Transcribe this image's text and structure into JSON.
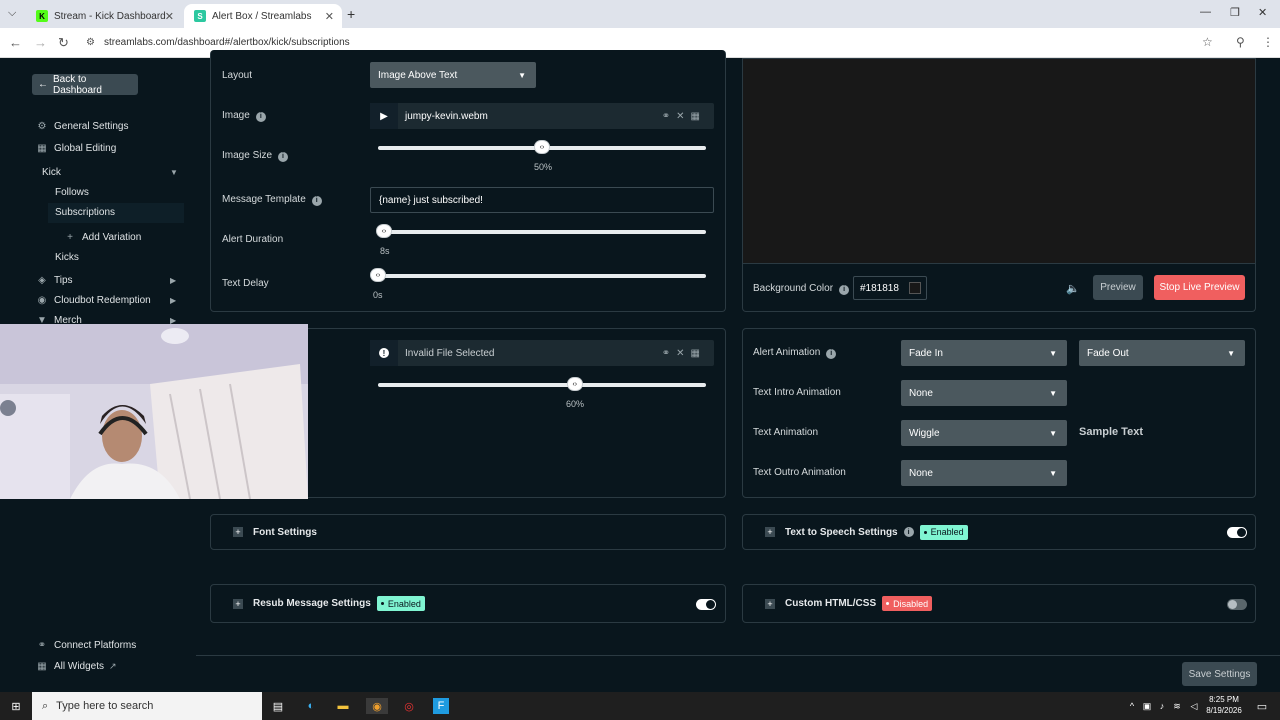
{
  "browser": {
    "tabs": [
      {
        "title": "Stream - Kick Dashboard",
        "fav": "K",
        "fav_color": "#53fc18"
      },
      {
        "title": "Alert Box / Streamlabs",
        "fav": "S",
        "fav_color": "#2cc8a0"
      }
    ],
    "url": "streamlabs.com/dashboard#/alertbox/kick/subscriptions"
  },
  "sidebar": {
    "back_label": "Back to Dashboard",
    "items": [
      {
        "label": "General Settings",
        "icon": "gear-icon"
      },
      {
        "label": "Global Editing",
        "icon": "grid-icon"
      },
      {
        "label": "Kick"
      },
      {
        "label": "Follows"
      },
      {
        "label": "Subscriptions"
      },
      {
        "label": "Add Variation"
      },
      {
        "label": "Kicks"
      },
      {
        "label": "Tips",
        "icon": "tag-icon"
      },
      {
        "label": "Cloudbot Redemption",
        "icon": "bot-icon"
      },
      {
        "label": "Merch",
        "icon": "shirt-icon"
      }
    ],
    "connect": "Connect Platforms",
    "widgets": "All Widgets"
  },
  "settings": {
    "layout_label": "Layout",
    "layout_value": "Image Above Text",
    "image_label": "Image",
    "image_file": "jumpy-kevin.webm",
    "image_size_label": "Image Size",
    "image_size_value": "50%",
    "image_size_fraction": 0.5,
    "message_template_label": "Message Template",
    "message_template_value": "{name} just subscribed!",
    "alert_duration_label": "Alert Duration",
    "alert_duration_value": "8s",
    "text_delay_label": "Text Delay",
    "text_delay_value": "0s",
    "sound_file": "Invalid File Selected",
    "sound_volume_value": "60%",
    "sound_volume_fraction": 0.6
  },
  "preview": {
    "bg_color_label": "Background Color",
    "bg_color_value": "#181818",
    "preview_btn": "Preview",
    "stop_btn": "Stop Live Preview"
  },
  "animation": {
    "alert_label": "Alert Animation",
    "alert_in": "Fade In",
    "alert_out": "Fade Out",
    "intro_label": "Text Intro Animation",
    "intro_value": "None",
    "text_label": "Text Animation",
    "text_value": "Wiggle",
    "sample": "Sample Text",
    "outro_label": "Text Outro Animation",
    "outro_value": "None"
  },
  "sections": {
    "font": "Font Settings",
    "tts": "Text to Speech Settings",
    "tts_status": "Enabled",
    "resub": "Resub Message Settings",
    "resub_status": "Enabled",
    "custom": "Custom HTML/CSS",
    "custom_status": "Disabled",
    "save": "Save Settings"
  },
  "taskbar": {
    "search_placeholder": "Type here to search",
    "time": "8:25 PM",
    "date": "8/19/2026"
  }
}
